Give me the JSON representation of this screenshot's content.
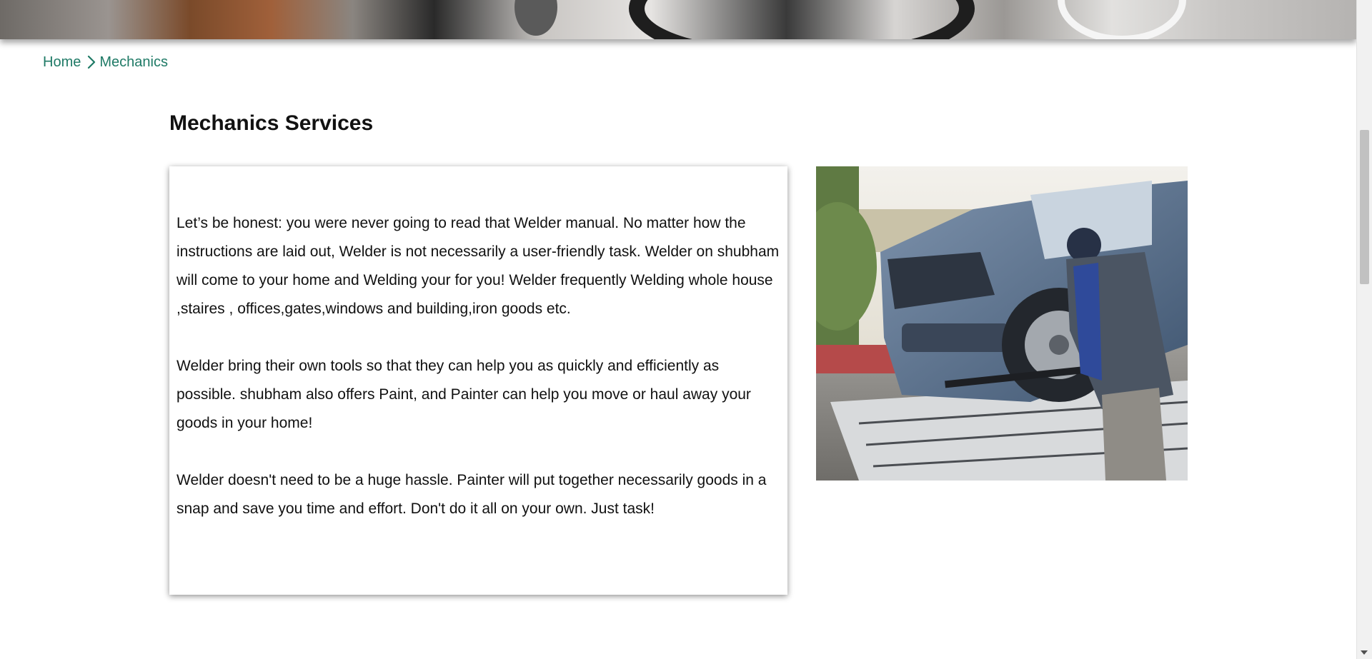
{
  "breadcrumb": {
    "home": "Home",
    "current": "Mechanics"
  },
  "page": {
    "title": "Mechanics Services"
  },
  "content": {
    "paragraphs": [
      "Let’s be honest: you were never going to read that Welder manual. No matter how the instructions are laid out, Welder is not necessarily a user-friendly task. Welder on shubham will come to your home and Welding your for you! Welder frequently Welding whole house ,staires , offices,gates,windows and building,iron goods etc.",
      "Welder bring their own tools so that they can help you as quickly and efficiently as possible. shubham also offers Paint, and Painter can help you move or haul away your goods in your home!",
      "Welder doesn't need to be a huge hassle. Painter will put together necessarily goods in a snap and save you time and effort. Don't do it all on your own. Just task!"
    ]
  },
  "icons": {
    "breadcrumb_separator": "chevron-right-icon",
    "scroll_down": "chevron-down-icon"
  },
  "colors": {
    "link": "#1f7a66",
    "text": "#111111",
    "scroll_thumb": "#c1c1c1"
  }
}
